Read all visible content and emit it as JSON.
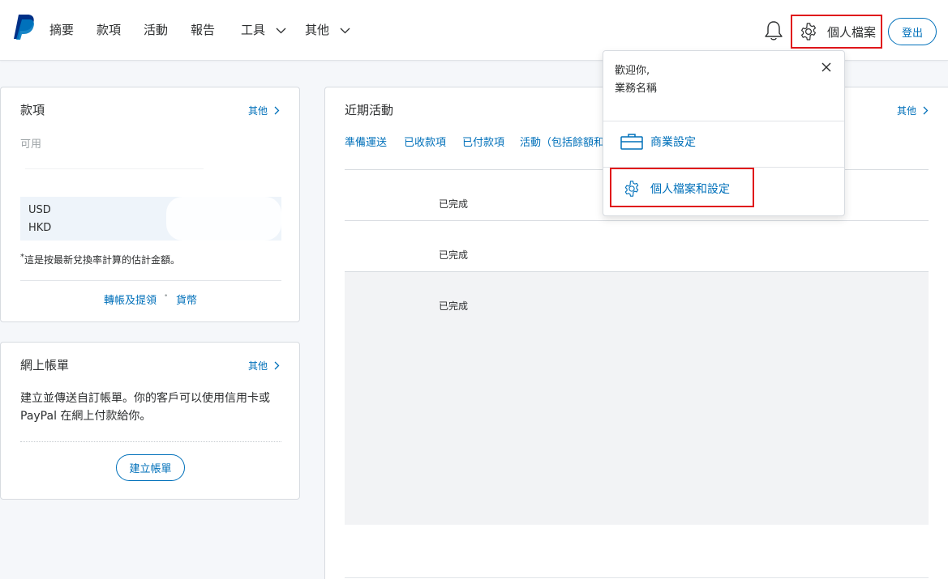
{
  "header": {
    "logo": "paypal-logo",
    "nav": [
      "摘要",
      "款項",
      "活動",
      "報告",
      "工具",
      "其他"
    ],
    "profile_label": "個人檔案",
    "logout_label": "登出",
    "icons": {
      "bell": "bell-icon",
      "gear": "gear-icon",
      "chevron": "chevron-down-icon"
    }
  },
  "payments_card": {
    "title": "款項",
    "more": "其他",
    "available_label": "可用",
    "currencies": [
      "USD",
      "HKD"
    ],
    "note": "這是按最新兌換率計算的估計金額。",
    "note_marker": "*",
    "links": {
      "transfer": "轉帳及提領",
      "separator": "•",
      "currency": "貨幣"
    }
  },
  "invoice_card": {
    "title": "網上帳單",
    "more": "其他",
    "description": "建立並傳送自訂帳單。你的客戶可以使用信用卡或 PayPal 在網上付款給你。",
    "create_button": "建立帳單"
  },
  "activity_card": {
    "title": "近期活動",
    "more": "其他",
    "tabs": [
      "準備運送",
      "已收款項",
      "已付款項",
      "活動（包括餘額和"
    ],
    "rows": [
      {
        "status": "已完成"
      },
      {
        "status": "已完成"
      },
      {
        "status": "已完成"
      }
    ]
  },
  "profile_dropdown": {
    "welcome": "歡迎你,",
    "business_name": "業務名稱",
    "items": [
      {
        "label": "商業設定",
        "icon": "briefcase-icon"
      },
      {
        "label": "個人檔案和設定",
        "icon": "gear-icon"
      }
    ]
  },
  "colors": {
    "brand_blue": "#0070ba",
    "paypal_dark": "#003087",
    "highlight_red": "#e0161b",
    "background": "#f5f7fa"
  }
}
